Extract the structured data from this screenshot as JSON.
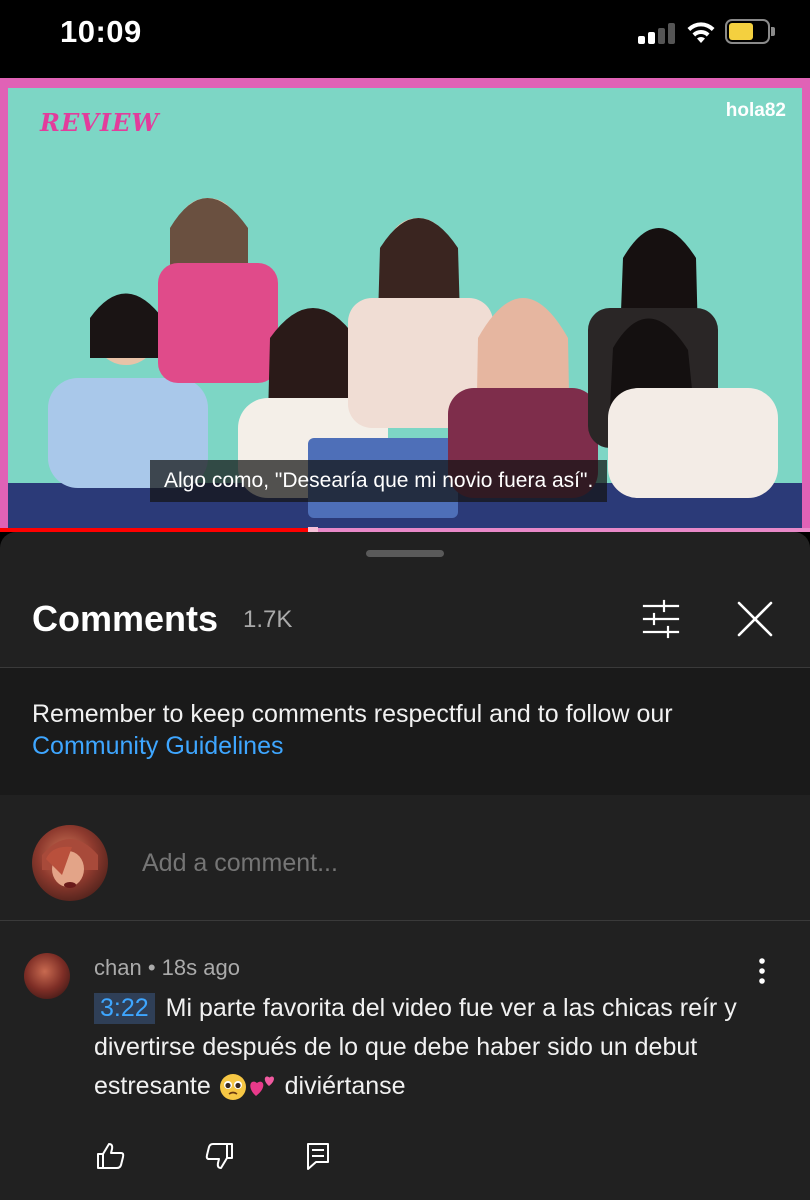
{
  "status_bar": {
    "time": "10:09",
    "signal_icon": "signal-icon",
    "wifi_icon": "wifi-icon",
    "battery_icon": "battery-icon",
    "battery_color": "#f4d03f"
  },
  "video": {
    "logo_left": "REVIEW",
    "logo_right": "hola82",
    "caption": "Algo como, \"Desearía que mi novio fuera así\".",
    "progress": 0.38,
    "progress_color": "#ff0000",
    "border_color": "#e062b6"
  },
  "comments_panel": {
    "title": "Comments",
    "count": "1.7K",
    "filter_icon": "filter-icon",
    "close_icon": "close-icon",
    "guidelines_text": "Remember to keep comments respectful and to follow our ",
    "guidelines_link": "Community Guidelines",
    "add_placeholder": "Add a comment...",
    "link_color": "#3ea6ff"
  },
  "comment": {
    "author": "chan",
    "separator": "•",
    "time": "18s ago",
    "timestamp": "3:22",
    "text": " Mi parte favorita del video fue ver a las chicas reír y divertirse después de lo que debe haber sido un debut estresante ",
    "emojis": [
      "pleading-face-emoji",
      "two-hearts-emoji"
    ],
    "text_end": " diviértanse",
    "actions": [
      "like-icon",
      "dislike-icon",
      "reply-icon"
    ],
    "menu_icon": "more-vert-icon"
  }
}
